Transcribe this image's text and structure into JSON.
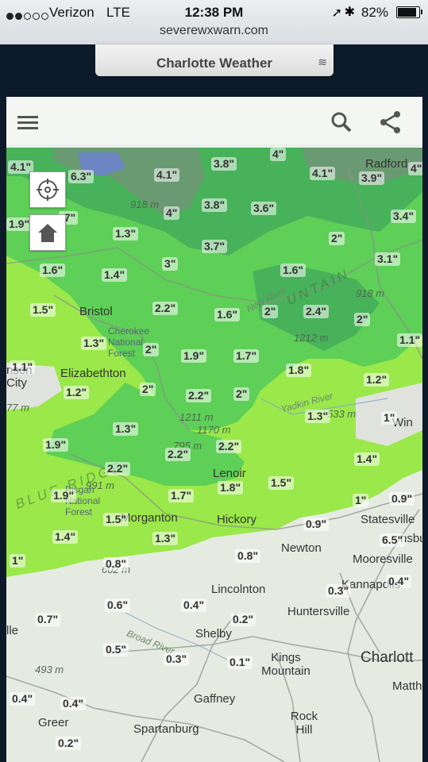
{
  "status": {
    "carrier": "Verizon",
    "network": "LTE",
    "time": "12:38 PM",
    "battery": "82%",
    "signal_bars": 2,
    "url": "severewxwarn.com"
  },
  "header": {
    "title": "Charlotte Weather"
  },
  "map": {
    "icons": {
      "menu": "menu-icon",
      "search": "search-icon",
      "share": "share-icon",
      "locate": "locate-icon",
      "home": "home-icon"
    },
    "accumulation_labels": [
      "4.1\"",
      "6.3\"",
      "4.1\"",
      "3.8\"",
      "4\"",
      "4.1\"",
      "3.9\"",
      "4\"",
      "918 m",
      "4\"",
      "3.8\"",
      "3.6\"",
      "3.4\"",
      ".7\"",
      "1.9\"",
      "1.3\"",
      "2\"",
      "3.7\"",
      "3\"",
      "3.1\"",
      "1.6\"",
      "1.4\"",
      "1.6\"",
      "1.5\"",
      "2.2\"",
      "1.6\"",
      "2\"",
      "2.4\"",
      "2\"",
      "1.3\"",
      "2\"",
      "1.9\"",
      "1.7\"",
      "1.1\"",
      "1.8\"",
      "1.2\"",
      "1.1\"",
      "1.2\"",
      "2\"",
      "2.2\"",
      "2\"",
      "1.3\"",
      "1\"",
      "1.3\"",
      "1.9\"",
      "2.2\"",
      "2.2\"",
      "1.4\"",
      "2.2\"",
      "1.8\"",
      "1.5\"",
      "1.9\"",
      "1.7\"",
      "1\"",
      "0.9\"",
      "1.5\"",
      "1.4\"",
      "1.3\"",
      "0.9\"",
      "6.5\"",
      "0.8\"",
      "1\"",
      "0.8\"",
      "0.4\"",
      "0.3\"",
      "0.6\"",
      "0.4\"",
      "0.7\"",
      "0.2\"",
      "0.5\"",
      "0.3\"",
      "0.1\"",
      "0.4\"",
      "0.4\"",
      "0.2\""
    ],
    "places": [
      "Bristol",
      "Elizabethton",
      "Cherokee National Forest",
      "Radford",
      "Lenoir",
      "Hickory",
      "Morganton",
      "Pisgah National Forest",
      "Statesville",
      "Newton",
      "Mooresville",
      "Lincolnton",
      "Huntersville",
      "Kannapolis",
      "Shelby",
      "Kings Mountain",
      "Charlott",
      "Matthe",
      "Gaffney",
      "Rock Hill",
      "Spartanburg",
      "Greer",
      "Win",
      "City",
      "nson",
      "lle",
      "nsbu"
    ],
    "elevations": [
      "918 m",
      "918 m",
      "1212 m",
      "1211 m",
      "1170 m",
      "795 m",
      "991 m",
      "602 m",
      "493 m",
      "533 m",
      "77 m"
    ],
    "rivers": [
      "New River",
      "Yadkin River",
      "Broad River"
    ],
    "region_text": [
      "BLUE RIDGE",
      "UNTAIN"
    ],
    "colors": {
      "light_green": "#9be84a",
      "mid_green": "#5ecf57",
      "dark_green": "#48b25a",
      "gray_green": "#6a9a72",
      "blue": "#6c86c4",
      "basemap": "#e6ebe2"
    }
  }
}
